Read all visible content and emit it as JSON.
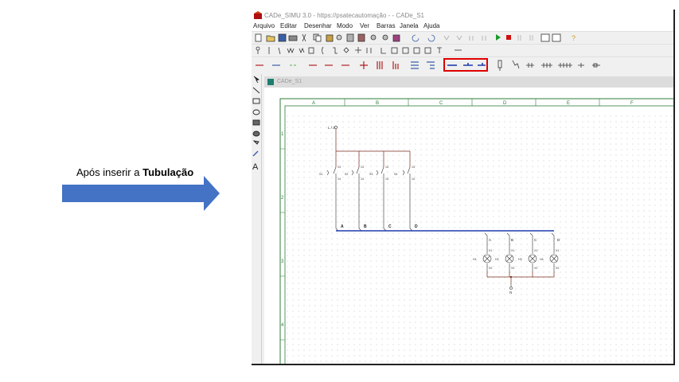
{
  "annotation": {
    "prefix": "Após inserir a ",
    "bold": "Tubulação"
  },
  "window": {
    "title": "CADe_SIMU 3.0 - https://psatecautomação - - CADe_S1",
    "menu": [
      "Arquivo",
      "Editar",
      "Desenhar",
      "Modo",
      "Ver",
      "Barras",
      "Janela",
      "Ajuda"
    ]
  },
  "child": {
    "title": "CADe_S1"
  },
  "sheet": {
    "col_labels": [
      "A",
      "B",
      "C",
      "D",
      "E",
      "F"
    ],
    "row_labels": [
      "1",
      "2",
      "3",
      "4"
    ],
    "supply_top": "L / 2",
    "supply_bottom": "N",
    "switches": [
      {
        "tag": "S1",
        "top": "13",
        "bottom": "14"
      },
      {
        "tag": "S2",
        "top": "13",
        "bottom": "14"
      },
      {
        "tag": "S3",
        "top": "13",
        "bottom": "14"
      },
      {
        "tag": "S4",
        "top": "13",
        "bottom": "14"
      }
    ],
    "bus_labels_top": [
      "A",
      "B",
      "C",
      "D"
    ],
    "bus_labels_bottom": [
      "A",
      "B",
      "C",
      "D"
    ],
    "lamps": [
      {
        "tag": "H1",
        "top": "X1",
        "bottom": "X2"
      },
      {
        "tag": "H2",
        "top": "X1",
        "bottom": "X2"
      },
      {
        "tag": "H3",
        "top": "X1",
        "bottom": "X2"
      },
      {
        "tag": "H4",
        "top": "X1",
        "bottom": "X2"
      }
    ]
  },
  "colors": {
    "highlight": "#e00000",
    "bus": "#1e3caa",
    "wire": "#7a2a1a",
    "frame": "#2e7d3a",
    "arrow": "#4472c4"
  }
}
